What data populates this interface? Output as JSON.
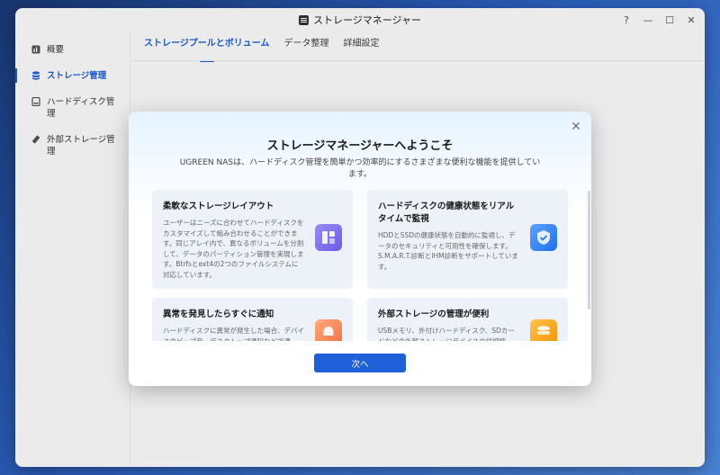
{
  "window": {
    "title": "ストレージマネージャー",
    "controls": {
      "help": "?",
      "minimize": "—",
      "maximize": "☐",
      "close": "✕"
    }
  },
  "sidebar": {
    "items": [
      {
        "label": "概要",
        "icon": "overview-icon",
        "active": false
      },
      {
        "label": "ストレージ管理",
        "icon": "database-icon",
        "active": true
      },
      {
        "label": "ハードディスク管理",
        "icon": "hard-disk-icon",
        "active": false
      },
      {
        "label": "外部ストレージ管理",
        "icon": "usb-drive-icon",
        "active": false
      }
    ]
  },
  "tabs": [
    {
      "label": "ストレージプールとボリューム",
      "active": true
    },
    {
      "label": "データ整理",
      "active": false
    },
    {
      "label": "詳細設定",
      "active": false
    }
  ],
  "dialog": {
    "title": "ストレージマネージャーへようこそ",
    "subtitle": "UGREEN NASは、ハードディスク管理を簡単かつ効率的にするさまざまな便利な機能を提供しています。",
    "cards": [
      {
        "title": "柔軟なストレージレイアウト",
        "description": "ユーザーはニーズに合わせてハードディスクをカスタマイズして組み合わせることができます。同じアレイ内で、異なるボリュームを分割して、データのパーティション管理を実現します。Btrfsとext4の2つのファイルシステムに対応しています。",
        "icon": "layout-icon",
        "icon_color": "#7b6cf0"
      },
      {
        "title": "ハードディスクの健康状態をリアルタイムで監視",
        "description": "HDDとSSDの健康状態を自動的に監視し、データのセキュリティと可用性を確保します。S.M.A.R.T.診断とIHM診断をサポートしています。",
        "icon": "shield-icon",
        "icon_color": "#2f80f5"
      },
      {
        "title": "異常を発見したらすぐに通知",
        "description": "ハードディスクに異常が発生した場合、デバイスのビープ音、デスクトップ通知などで通",
        "icon": "bell-icon",
        "icon_color": "#f58a5c"
      },
      {
        "title": "外部ストレージの管理が便利",
        "description": "USBメモリ、外付けハードディスク、SDカードなどの外部ストレージデバイスの詳細情",
        "icon": "storage-stack-icon",
        "icon_color": "#f7a21b"
      }
    ],
    "next_label": "次へ",
    "close_label": "✕"
  },
  "colors": {
    "accent": "#1f5fd9",
    "card_bg": "#edf1f8"
  }
}
